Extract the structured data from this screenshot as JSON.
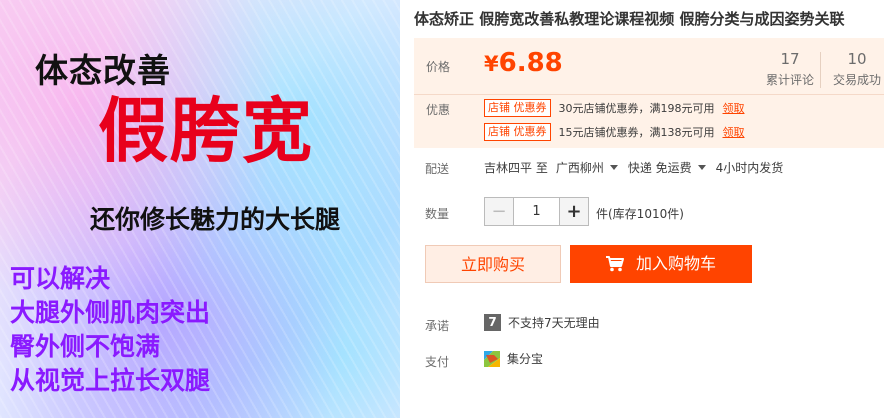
{
  "promo": {
    "line1": "体态改善",
    "line2": "假胯宽",
    "line3": "还你修长魅力的大长腿",
    "list": [
      "可以解决",
      "大腿外侧肌肉突出",
      "臀外侧不饱满",
      "从视觉上拉长双腿"
    ]
  },
  "product": {
    "title": "体态矫正 假胯宽改善私教理论课程视频 假胯分类与成因姿势关联"
  },
  "price": {
    "label": "价格",
    "currency": "¥",
    "value": "6.88",
    "reviews_count": "17",
    "reviews_label": "累计评论",
    "sales_count": "10",
    "sales_label": "交易成功"
  },
  "promotions": {
    "label": "优惠",
    "coupons": [
      {
        "tag": "店铺 优惠券",
        "text": "30元店铺优惠券，满198元可用",
        "action": "领取"
      },
      {
        "tag": "店铺 优惠券",
        "text": "15元店铺优惠券，满138元可用",
        "action": "领取"
      }
    ]
  },
  "shipping": {
    "label": "配送",
    "from": "吉林四平 至",
    "to": "广西柳州",
    "method": "快递 免运费",
    "delivery": "4小时内发货"
  },
  "quantity": {
    "label": "数量",
    "minus": "−",
    "value": "1",
    "plus": "+",
    "stock": "件(库存1010件)"
  },
  "actions": {
    "buy_now": "立即购买",
    "add_to_cart": "加入购物车"
  },
  "promise": {
    "label": "承诺",
    "icon_text": "7",
    "text": "不支持7天无理由"
  },
  "payment": {
    "label": "支付",
    "method": "集分宝"
  },
  "colors": {
    "accent": "#ff4400",
    "price_bg": "#fff2e8",
    "promo_red": "#e8001c",
    "promo_purple": "#8a1aff"
  }
}
